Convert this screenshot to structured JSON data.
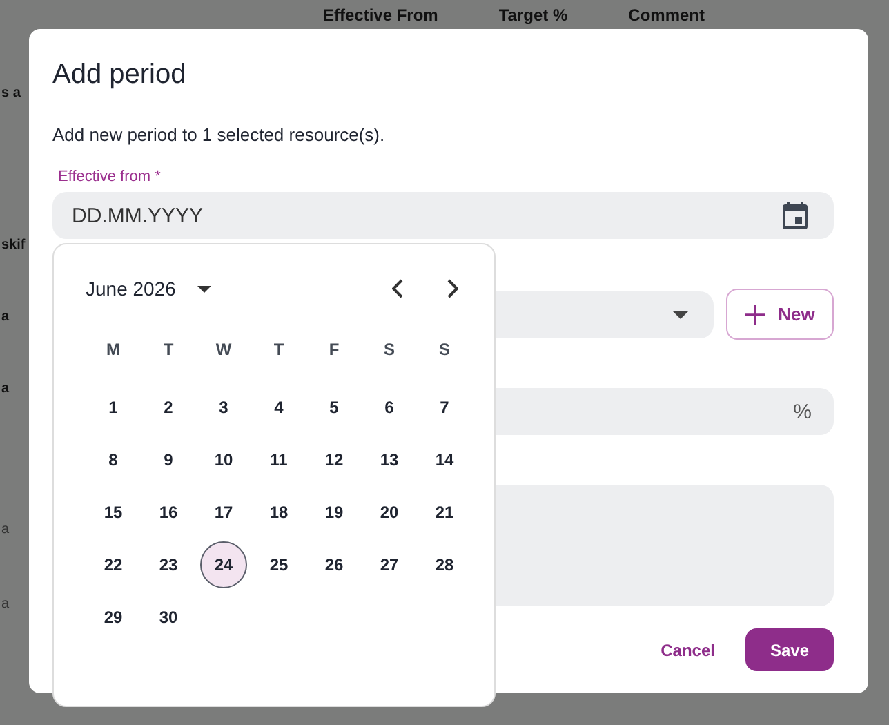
{
  "background": {
    "columns": [
      "Effective From",
      "Target %",
      "Comment"
    ],
    "row_fragments": [
      {
        "text": "s a",
        "muted": false
      },
      {
        "text": "skif",
        "muted": false
      },
      {
        "text": "a",
        "muted": false
      },
      {
        "text": "a",
        "muted": false
      },
      {
        "text": "a",
        "muted": true
      },
      {
        "text": "a",
        "muted": true
      }
    ]
  },
  "dialog": {
    "title": "Add period",
    "subtitle": "Add new period to 1 selected resource(s).",
    "date_field": {
      "label": "Effective from *",
      "placeholder": "DD.MM.YYYY"
    },
    "new_button": "New",
    "percent_suffix": "%",
    "buttons": {
      "cancel": "Cancel",
      "save": "Save"
    }
  },
  "calendar": {
    "month": "June 2026",
    "weekdays": [
      "M",
      "T",
      "W",
      "T",
      "F",
      "S",
      "S"
    ],
    "days": [
      {
        "label": "1",
        "selected": false
      },
      {
        "label": "2",
        "selected": false
      },
      {
        "label": "3",
        "selected": false
      },
      {
        "label": "4",
        "selected": false
      },
      {
        "label": "5",
        "selected": false
      },
      {
        "label": "6",
        "selected": false
      },
      {
        "label": "7",
        "selected": false
      },
      {
        "label": "8",
        "selected": false
      },
      {
        "label": "9",
        "selected": false
      },
      {
        "label": "10",
        "selected": false
      },
      {
        "label": "11",
        "selected": false
      },
      {
        "label": "12",
        "selected": false
      },
      {
        "label": "13",
        "selected": false
      },
      {
        "label": "14",
        "selected": false
      },
      {
        "label": "15",
        "selected": false
      },
      {
        "label": "16",
        "selected": false
      },
      {
        "label": "17",
        "selected": false
      },
      {
        "label": "18",
        "selected": false
      },
      {
        "label": "19",
        "selected": false
      },
      {
        "label": "20",
        "selected": false
      },
      {
        "label": "21",
        "selected": false
      },
      {
        "label": "22",
        "selected": false
      },
      {
        "label": "23",
        "selected": false
      },
      {
        "label": "24",
        "selected": true
      },
      {
        "label": "25",
        "selected": false
      },
      {
        "label": "26",
        "selected": false
      },
      {
        "label": "27",
        "selected": false
      },
      {
        "label": "28",
        "selected": false
      },
      {
        "label": "29",
        "selected": false
      },
      {
        "label": "30",
        "selected": false
      }
    ]
  }
}
